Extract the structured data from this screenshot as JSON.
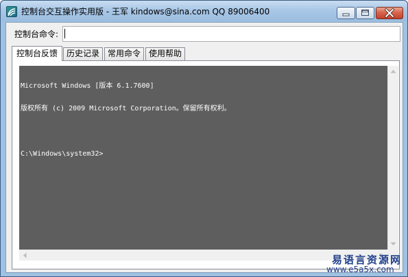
{
  "window": {
    "title": "控制台交互操作实用版 - 王军 kindows@sina.com  QQ 89006400",
    "icons": {
      "app": "console-app-icon",
      "minimize": "minimize-icon",
      "maximize": "maximize-icon",
      "close": "close-icon"
    }
  },
  "command": {
    "label": "控制台命令:",
    "value": ""
  },
  "tabs": [
    {
      "label": "控制台反馈",
      "active": true
    },
    {
      "label": "历史记录",
      "active": false
    },
    {
      "label": "常用命令",
      "active": false
    },
    {
      "label": "使用帮助",
      "active": false
    }
  ],
  "console": {
    "lines": [
      "Microsoft Windows [版本 6.1.7600]",
      "版权所有 (c) 2009 Microsoft Corporation。保留所有权利。",
      "",
      "C:\\Windows\\system32>"
    ],
    "background": "#5e5e5e",
    "foreground": "#ffffff"
  },
  "watermark": {
    "name": "易语言资源网",
    "url": "www.e5a5x.com"
  },
  "colors": {
    "titlebar": "#a9c7e6",
    "close_button": "#c4412a",
    "client_bg": "#f0f0f0"
  }
}
